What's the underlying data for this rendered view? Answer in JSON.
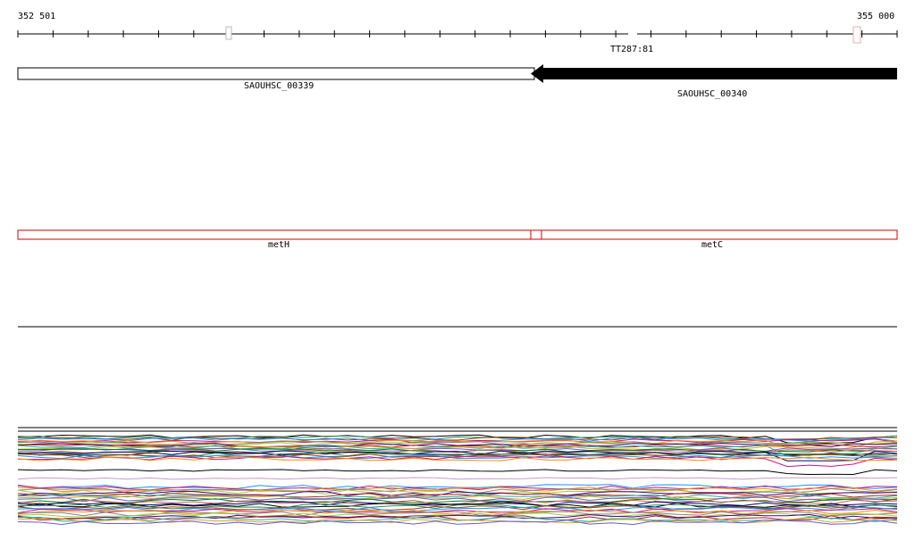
{
  "ruler": {
    "start_label": "352 501",
    "end_label": "355 000"
  },
  "features": {
    "terminator": {
      "label": "TT287:81"
    },
    "genes": [
      {
        "label": "SAOUHSC_00339",
        "strand": "+"
      },
      {
        "label": "SAOUHSC_00340",
        "strand": "-"
      }
    ],
    "annotations": [
      {
        "label": "metH"
      },
      {
        "label": "metC"
      }
    ]
  },
  "coverage": {
    "colors": [
      "#000000",
      "#2e8b57",
      "#8b4513",
      "#1e90ff",
      "#c71585",
      "#ff8c00",
      "#808080",
      "#9acd32",
      "#4b0082",
      "#b22222",
      "#20b2aa",
      "#daa520",
      "#6a5acd",
      "#008000",
      "#cd5c5c",
      "#000080"
    ]
  }
}
